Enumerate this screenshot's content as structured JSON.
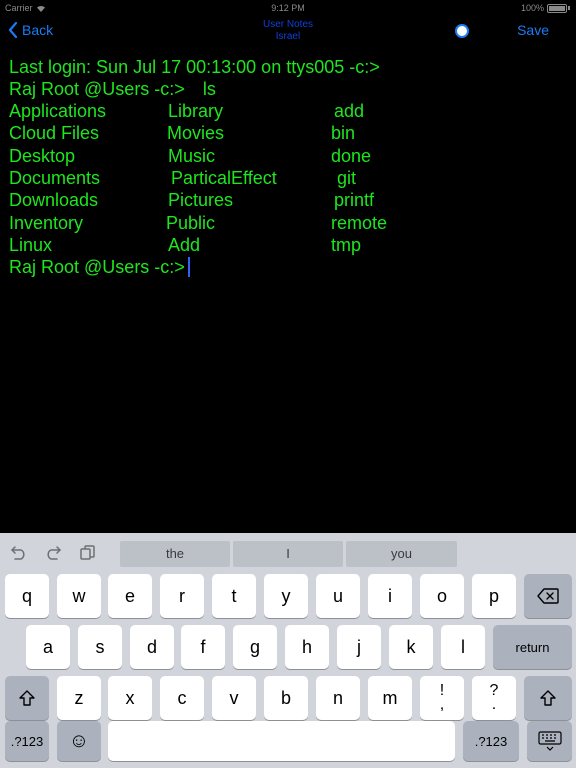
{
  "status_bar": {
    "carrier": "Carrier",
    "time": "9:12 PM",
    "battery": "100%"
  },
  "nav": {
    "back_label": "Back",
    "title_line1": "User Notes",
    "title_line2": "Israel",
    "save_label": "Save"
  },
  "terminal": {
    "login_line": "Last login: Sun Jul 17 00:13:00 on ttys005 -c:>",
    "prompt": "Raj Root @Users -c:>",
    "command": "ls",
    "rows": [
      [
        "Applications",
        "Library",
        "add"
      ],
      [
        "Cloud Files",
        "Movies",
        "bin"
      ],
      [
        "Desktop",
        "Music",
        "done"
      ],
      [
        "Documents",
        "ParticalEffect",
        "git"
      ],
      [
        "Downloads",
        "Pictures",
        "printf"
      ],
      [
        "Inventory",
        "Public",
        "remote"
      ],
      [
        "Linux",
        "Add",
        "tmp"
      ]
    ],
    "text_color": "#1ee61e",
    "cursor_color": "#2d64ff"
  },
  "keyboard": {
    "suggestions": [
      "the",
      "I",
      "you"
    ],
    "row1": [
      "q",
      "w",
      "e",
      "r",
      "t",
      "y",
      "u",
      "i",
      "o",
      "p"
    ],
    "row2": [
      "a",
      "s",
      "d",
      "f",
      "g",
      "h",
      "j",
      "k",
      "l"
    ],
    "row3": [
      "z",
      "x",
      "c",
      "v",
      "b",
      "n",
      "m"
    ],
    "return_label": "return",
    "numbers_label": ".?123",
    "exclaim_top": "!",
    "exclaim_bottom": ",",
    "question_top": "?",
    "question_bottom": ".",
    "emoji_glyph": "☺",
    "delete_glyph": "⌫",
    "shift_glyph": "⇧",
    "keyboard_glyph": "⌨"
  },
  "accent_color": "#1a7cf4"
}
